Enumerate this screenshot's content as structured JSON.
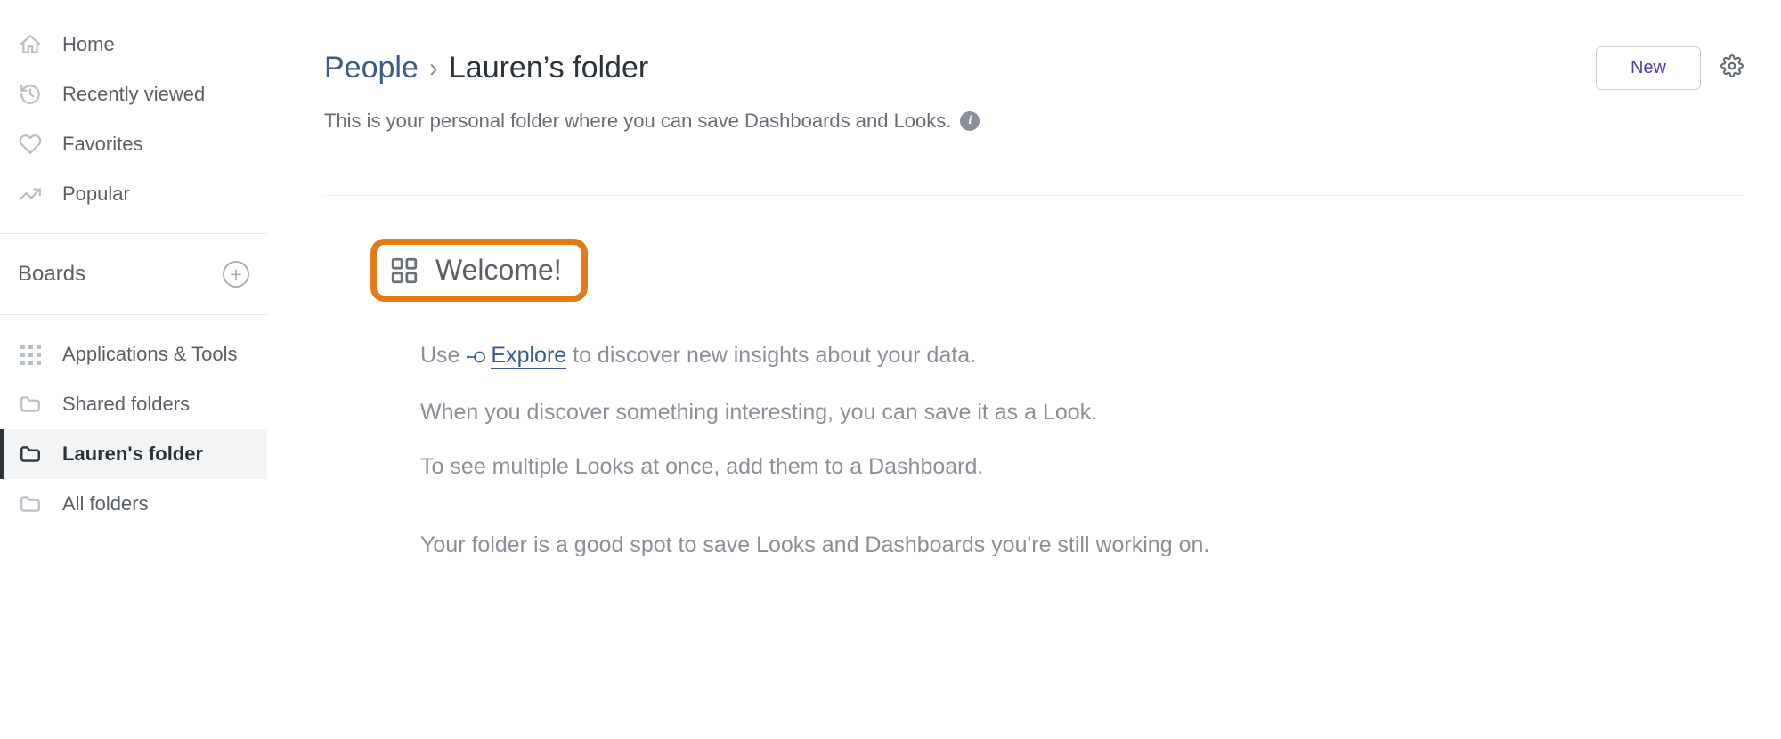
{
  "sidebar": {
    "nav": [
      {
        "label": "Home"
      },
      {
        "label": "Recently viewed"
      },
      {
        "label": "Favorites"
      },
      {
        "label": "Popular"
      }
    ],
    "boards_label": "Boards",
    "folders": [
      {
        "label": "Applications & Tools"
      },
      {
        "label": "Shared folders"
      },
      {
        "label": "Lauren's folder",
        "active": true
      },
      {
        "label": "All folders"
      }
    ]
  },
  "breadcrumb": {
    "parent": "People",
    "current": "Lauren’s folder"
  },
  "header": {
    "new_label": "New",
    "subdescription": "This is your personal folder where you can save Dashboards and Looks."
  },
  "welcome": {
    "title": "Welcome!",
    "line1_pre": "Use ",
    "line1_link": "Explore",
    "line1_post": " to discover new insights about your data.",
    "line2": "When you discover something interesting, you can save it as a Look.",
    "line3": "To see multiple Looks at once, add them to a Dashboard.",
    "line4": "Your folder is a good spot to save Looks and Dashboards you're still working on."
  }
}
